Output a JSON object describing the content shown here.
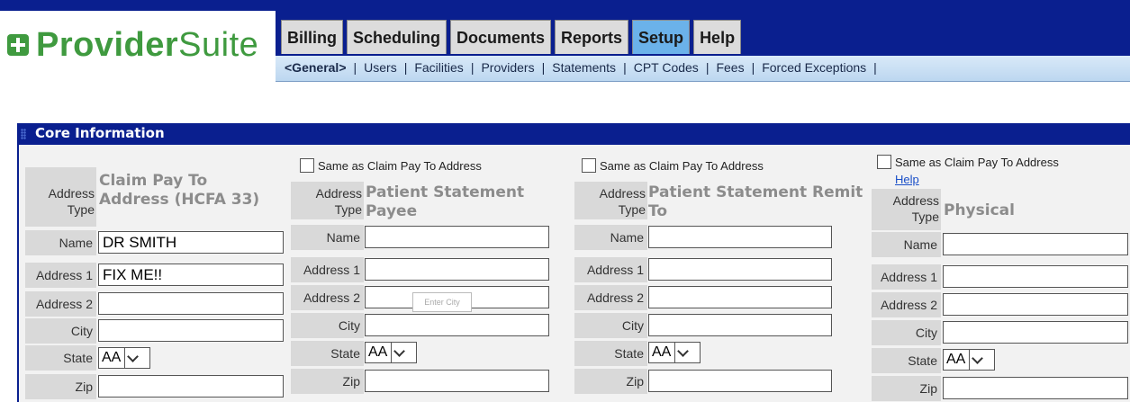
{
  "app": {
    "logo_text": "ProviderSuite",
    "logo_bold": "Provider",
    "logo_light": "Suite"
  },
  "tabs": [
    {
      "label": "Billing"
    },
    {
      "label": "Scheduling"
    },
    {
      "label": "Documents"
    },
    {
      "label": "Reports"
    },
    {
      "label": "Setup",
      "active": true
    },
    {
      "label": "Help"
    }
  ],
  "subnav": [
    {
      "label": "<General>",
      "current": true
    },
    {
      "label": "Users"
    },
    {
      "label": "Facilities"
    },
    {
      "label": "Providers"
    },
    {
      "label": "Statements"
    },
    {
      "label": "CPT Codes"
    },
    {
      "label": "Fees"
    },
    {
      "label": "Forced Exceptions"
    }
  ],
  "subnav_sep": "|",
  "panel": {
    "title": "Core Information"
  },
  "labels": {
    "address_type": "Address Type",
    "address": "Address",
    "type": "Type",
    "name": "Name",
    "address1": "Address 1",
    "address2": "Address 2",
    "city": "City",
    "state": "State",
    "zip": "Zip",
    "same_as": "Same as Claim Pay To Address",
    "help": "Help"
  },
  "columns": [
    {
      "type_value": "Claim Pay To Address (HCFA 33)",
      "name": "DR SMITH",
      "address1": "FIX ME!!",
      "address2": "",
      "city": "",
      "state": "AA",
      "zip": ""
    },
    {
      "type_value": "Patient Statement Payee",
      "name": "",
      "address1": "",
      "address2": "",
      "city": "",
      "state": "AA",
      "zip": ""
    },
    {
      "type_value": "Patient Statement Remit To",
      "name": "",
      "address1": "",
      "address2": "",
      "city": "",
      "state": "AA",
      "zip": ""
    },
    {
      "type_value": "Physical",
      "name": "",
      "address1": "",
      "address2": "",
      "city": "",
      "state": "AA",
      "zip": ""
    }
  ],
  "tooltip": "Enter City",
  "colors": {
    "brand_green": "#3f9a3f",
    "nav_blue": "#0a1f8f",
    "active_tab": "#6bb2ea"
  }
}
